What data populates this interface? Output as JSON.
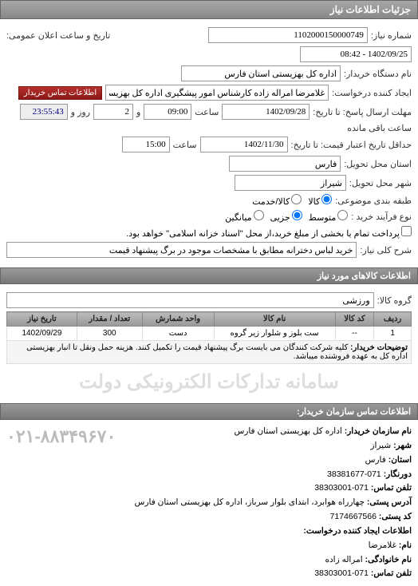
{
  "panel_title": "جزئیات اطلاعات نیاز",
  "fields": {
    "request_no_label": "شماره نیاز:",
    "request_no": "1102000150000749",
    "announce_label": "تاریخ و ساعت اعلان عمومی:",
    "announce_value": "1402/09/25 - 08:42",
    "buyer_org_label": "نام دستگاه خریدار:",
    "buyer_org": "اداره کل بهزیستی استان فارس",
    "creator_label": "ایجاد کننده درخواست:",
    "creator": "غلامرضا امراله زاده کارشناس امور پیشگیری اداره کل بهزیستی استان فارس",
    "contact_btn": "اطلاعات تماس خریدار",
    "deadline_send_label": "مهلت ارسال پاسخ: تا تاریخ:",
    "deadline_send_date": "1402/09/28",
    "time_label": "ساعت",
    "deadline_send_time": "09:00",
    "and_label": "و",
    "days_value": "2",
    "days_label": "روز و",
    "remaining_time": "23:55:43",
    "remaining_label": "ساعت باقی مانده",
    "valid_until_label": "حداقل تاریخ اعتبار قیمت: تا تاریخ:",
    "valid_until_date": "1402/11/30",
    "valid_until_time": "15:00",
    "province_label": "استان محل تحویل:",
    "province": "فارس",
    "city_label": "شهر محل تحویل:",
    "city": "شیراز",
    "group_type_label": "طبقه بندی موضوعی:",
    "group_kala": "کالا",
    "group_service": "کالا/خدمت",
    "purchase_type_label": "نوع فرآیند خرید :",
    "pt_medium": "متوسط",
    "pt_partial": "جزیی",
    "pt_avg": "میانگین",
    "payment_note_label": "پرداخت تمام یا بخشی از مبلغ خرید،از محل \"اسناد خزانه اسلامی\" خواهد بود.",
    "summary_label": "شرح کلی نیاز:",
    "summary": "خرید لباس دخترانه مطابق با مشخصات موجود در برگ پیشنهاد قیمت",
    "goods_header": "اطلاعات کالاهای مورد نیاز",
    "goods_group_label": "گروه کالا:",
    "goods_group": "ورزشی"
  },
  "table": {
    "headers": {
      "row": "ردیف",
      "code": "کد کالا",
      "name": "نام کالا",
      "unit": "واحد شمارش",
      "qty": "تعداد / مقدار",
      "date": "تاریخ نیاز"
    },
    "rows": [
      {
        "row": "1",
        "code": "--",
        "name": "ست بلوز و شلوار زیر گروه",
        "unit": "دست",
        "qty": "300",
        "date": "1402/09/29"
      }
    ],
    "desc_label": "توضیحات خریدار:",
    "desc": "کلیه شرکت کنندگان می بایست برگ پیشنهاد قیمت را تکمیل کنند. هزینه حمل ونقل تا انبار بهزیستی اداره کل به عهده فروشنده میباشد."
  },
  "watermark": "سامانه تدارکات الکترونیکی دولت",
  "contact": {
    "header": "اطلاعات تماس سازمان خریدار:",
    "org_name_label": "نام سازمان خریدار:",
    "org_name": "اداره کل بهزیستی استان فارس",
    "city_label": "شهر:",
    "city": "شیراز",
    "province_label": "استان:",
    "province": "فارس",
    "fax_label": "دورنگار:",
    "fax": "071-38381677",
    "phone_label": "تلفن تماس:",
    "phone": "071-38303001",
    "address_label": "آدرس پستی:",
    "address": "چهارراه هوابرد، ابتدای بلوار سرباز، اداره کل بهزیستی استان فارس",
    "postal_label": "کد پستی:",
    "postal": "7174667566",
    "creator_header": "اطلاعات ایجاد کننده درخواست:",
    "name_label": "نام:",
    "name": "غلامرضا",
    "lname_label": "نام خانوادگی:",
    "lname": "امراله زاده",
    "creator_phone_label": "تلفن تماس:",
    "creator_phone": "071-38303001",
    "big_phone": "۰۲۱-۸۸۳۴۹۶۷۰"
  }
}
